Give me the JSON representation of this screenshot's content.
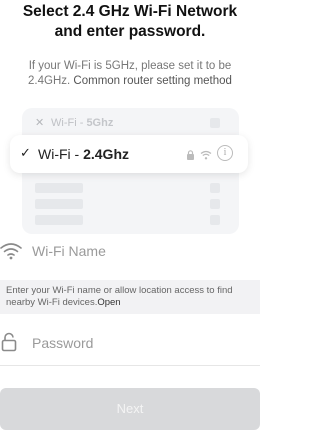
{
  "header": {
    "title_line1": "Select 2.4 GHz Wi-Fi Network",
    "title_line2": "and enter password.",
    "subtitle_line1": "If your Wi-Fi is 5GHz, please set it to be",
    "subtitle_line2_prefix": "2.4GHz.",
    "subtitle_link": "Common router setting method"
  },
  "illustration": {
    "faded_network_prefix": "Wi-Fi - ",
    "faded_network_band": "5Ghz",
    "selected_network_prefix": "Wi-Fi - ",
    "selected_network_band": "2.4Ghz",
    "check_glyph": "✓",
    "x_glyph": "✕",
    "info_glyph": "i"
  },
  "wifi_field": {
    "placeholder": "Wi-Fi Name",
    "icon": "wifi-icon"
  },
  "notice": {
    "text": "Enter your Wi-Fi name or allow location access to find nearby Wi-Fi devices.",
    "link": "Open"
  },
  "password_field": {
    "placeholder": "Password",
    "icon": "lock-icon"
  },
  "next_button": {
    "label": "Next",
    "background": "#d8d9db"
  }
}
